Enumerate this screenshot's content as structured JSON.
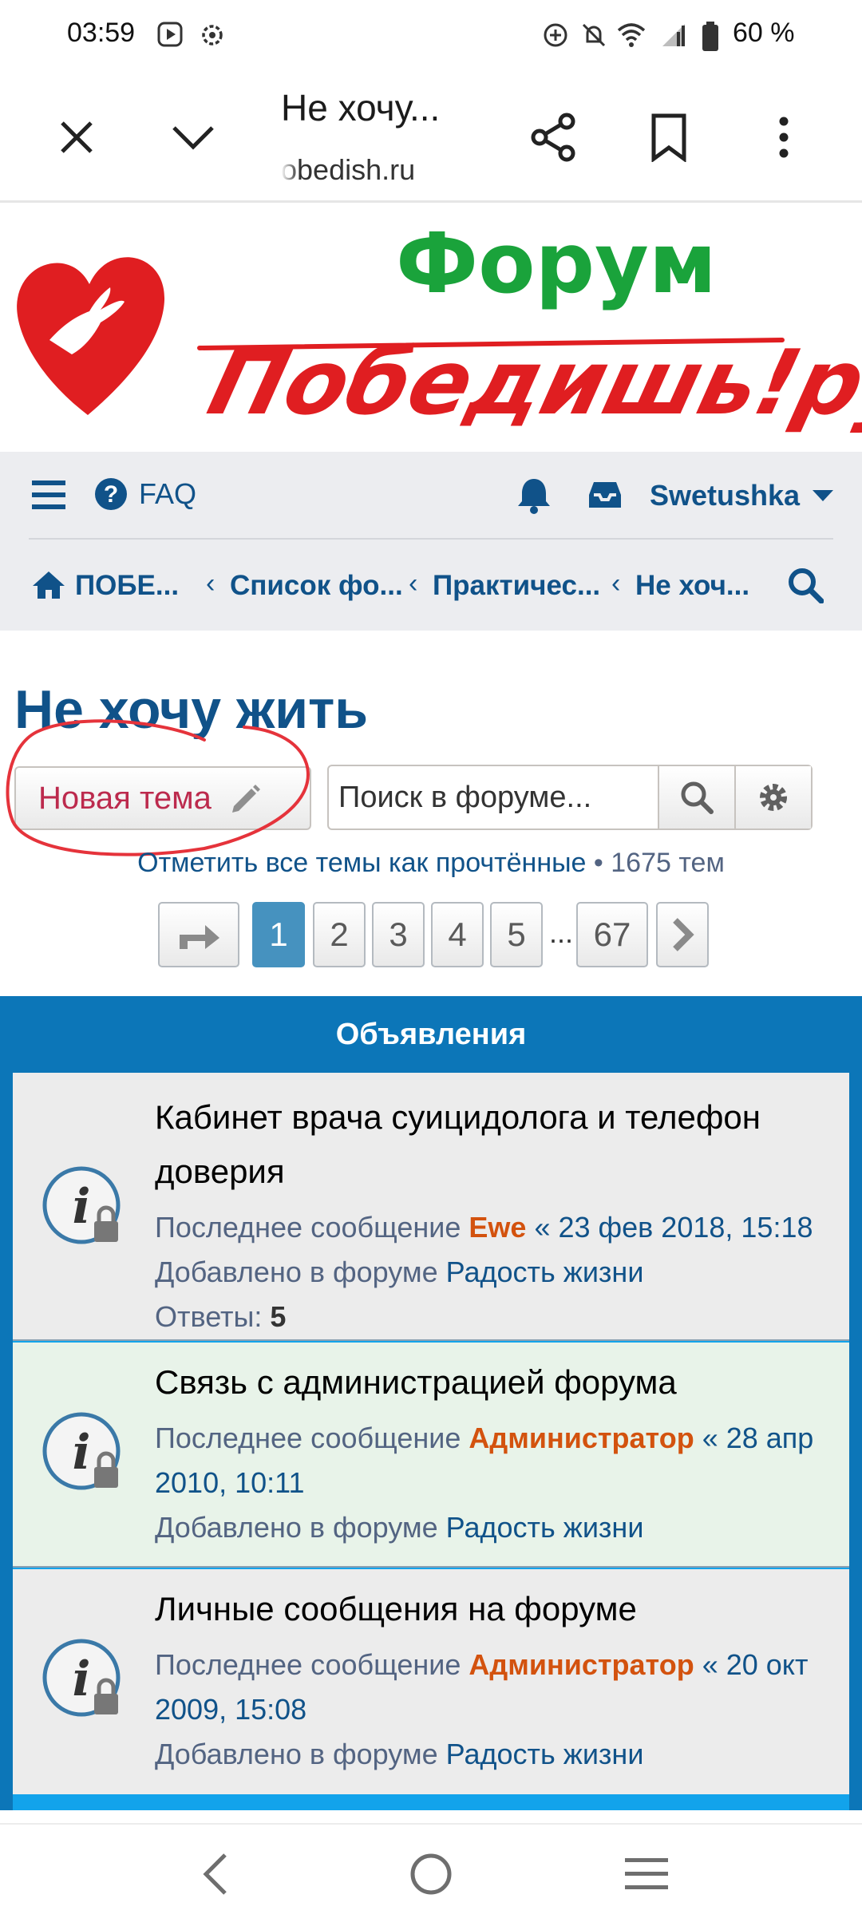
{
  "status_bar": {
    "time": "03:59",
    "battery": "60 %",
    "icons": [
      "media-icon",
      "settings-icon",
      "data-saver-icon",
      "mute-icon",
      "wifi-icon",
      "signal-icon",
      "battery-icon"
    ]
  },
  "browser": {
    "page_title": "Не хочу...",
    "url": "obedish.ru",
    "actions": [
      "close-icon",
      "chevron-down-icon",
      "share-icon",
      "bookmark-icon",
      "more-icon"
    ]
  },
  "banner": {
    "forum_word": "Форум",
    "brand_word": "Победишь!ру",
    "colors": {
      "green": "#1aa33b",
      "red": "#e01e21"
    }
  },
  "nav": {
    "faq": "FAQ",
    "username": "Swetushka",
    "breadcrumbs": [
      "ПОБЕ...",
      "Список фо...",
      "Практичес...",
      "Не хоч..."
    ]
  },
  "topic": {
    "title": "Не хочу жить",
    "new_topic_label": "Новая тема",
    "search_placeholder": "Поиск в форуме...",
    "mark_read": "Отметить все темы как прочтённые",
    "topic_count": "• 1675 тем"
  },
  "pagination": {
    "pages": [
      "1",
      "2",
      "3",
      "4",
      "5"
    ],
    "ellipsis": "...",
    "last": "67",
    "current": "1"
  },
  "announcements": {
    "header": "Объявления",
    "items": [
      {
        "title_line1": "Кабинет врача суицидолога и телефон",
        "title_line2": "доверия",
        "last_label": "Последнее сообщение",
        "author": "Ewe",
        "date": "« 23 фев 2018, 15:18",
        "added_label": "Добавлено в форуме",
        "forum": "Радость жизни",
        "replies_label": "Ответы:",
        "replies": "5"
      },
      {
        "title_line1": "Связь с администрацией форума",
        "last_label": "Последнее сообщение",
        "author": "Администратор",
        "date_part1": "« 28 апр",
        "date_part2": "2010, 10:11",
        "added_label": "Добавлено в форуме",
        "forum": "Радость жизни"
      },
      {
        "title_line1": "Личные сообщения на форуме",
        "last_label": "Последнее сообщение",
        "author": "Администратор",
        "date_part1": "« 20 окт",
        "date_part2": "2009, 15:08",
        "added_label": "Добавлено в форуме",
        "forum": "Радость жизни"
      }
    ],
    "row_colors": [
      "#ececec",
      "#e8f3e9",
      "#ececec"
    ]
  },
  "system_nav": [
    "back-icon",
    "home-icon",
    "recents-icon"
  ]
}
